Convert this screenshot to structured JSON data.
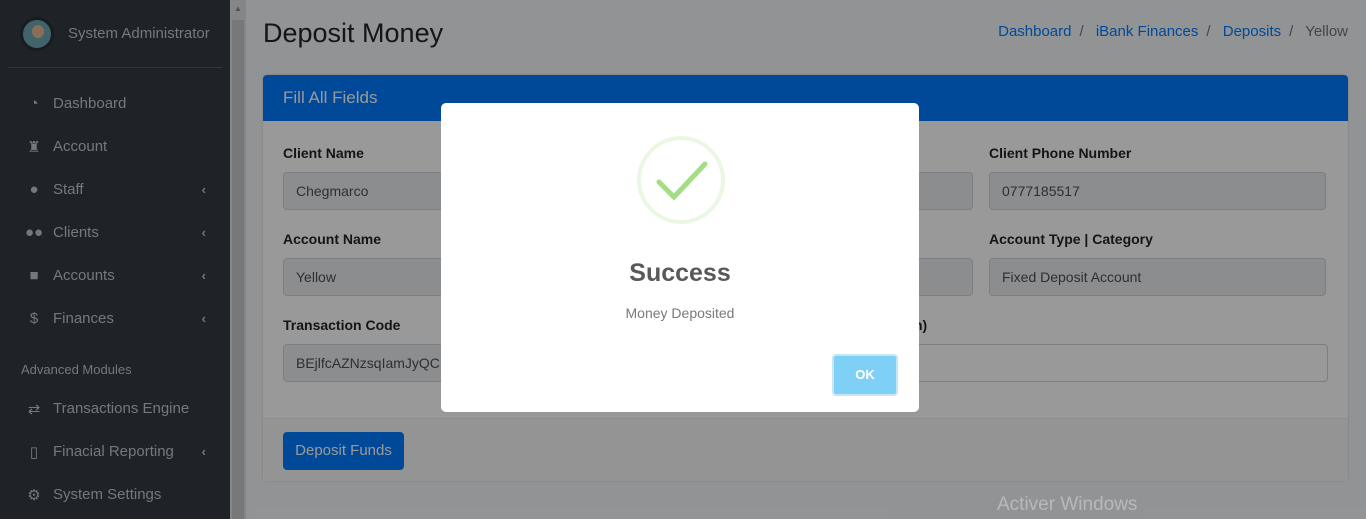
{
  "sidebar": {
    "user": "System Administrator",
    "items": [
      {
        "label": "Dashboard",
        "icon": "gauge-icon"
      },
      {
        "label": "Account",
        "icon": "user-secret-icon"
      },
      {
        "label": "Staff",
        "icon": "user-tie-icon"
      },
      {
        "label": "Clients",
        "icon": "users-icon"
      },
      {
        "label": "Accounts",
        "icon": "briefcase-icon"
      },
      {
        "label": "Finances",
        "icon": "dollar-icon"
      }
    ],
    "section": "Advanced Modules",
    "items2": [
      {
        "label": "Transactions Engine",
        "icon": "exchange-icon"
      },
      {
        "label": "Finacial Reporting",
        "icon": "file-invoice-dollar-icon"
      },
      {
        "label": "System Settings",
        "icon": "cogs-icon"
      }
    ]
  },
  "page": {
    "title": "Deposit Money",
    "breadcrumb": [
      "Dashboard",
      "iBank Finances",
      "Deposits",
      "Yellow"
    ]
  },
  "card": {
    "header": "Fill All Fields",
    "fields": {
      "client_name": {
        "label": "Client Name",
        "value": "Chegmarco"
      },
      "client_phone": {
        "label": "Client Phone Number",
        "value": "0777185517"
      },
      "account_name": {
        "label": "Account Name",
        "value": "Yellow"
      },
      "account_type": {
        "label": "Account Type | Category",
        "value": "Fixed Deposit Account"
      },
      "transaction_code": {
        "label": "Transaction Code",
        "value": "BEjlfcAZNzsqIamJyQC"
      },
      "amount": {
        "label": "Amount Deposited(Ksh)",
        "value": ""
      }
    },
    "submit": "Deposit Funds"
  },
  "modal": {
    "title": "Success",
    "text": "Money Deposited",
    "ok": "OK",
    "icon": "check-icon",
    "accent": "#a5dc86"
  },
  "watermark": "Activer Windows"
}
